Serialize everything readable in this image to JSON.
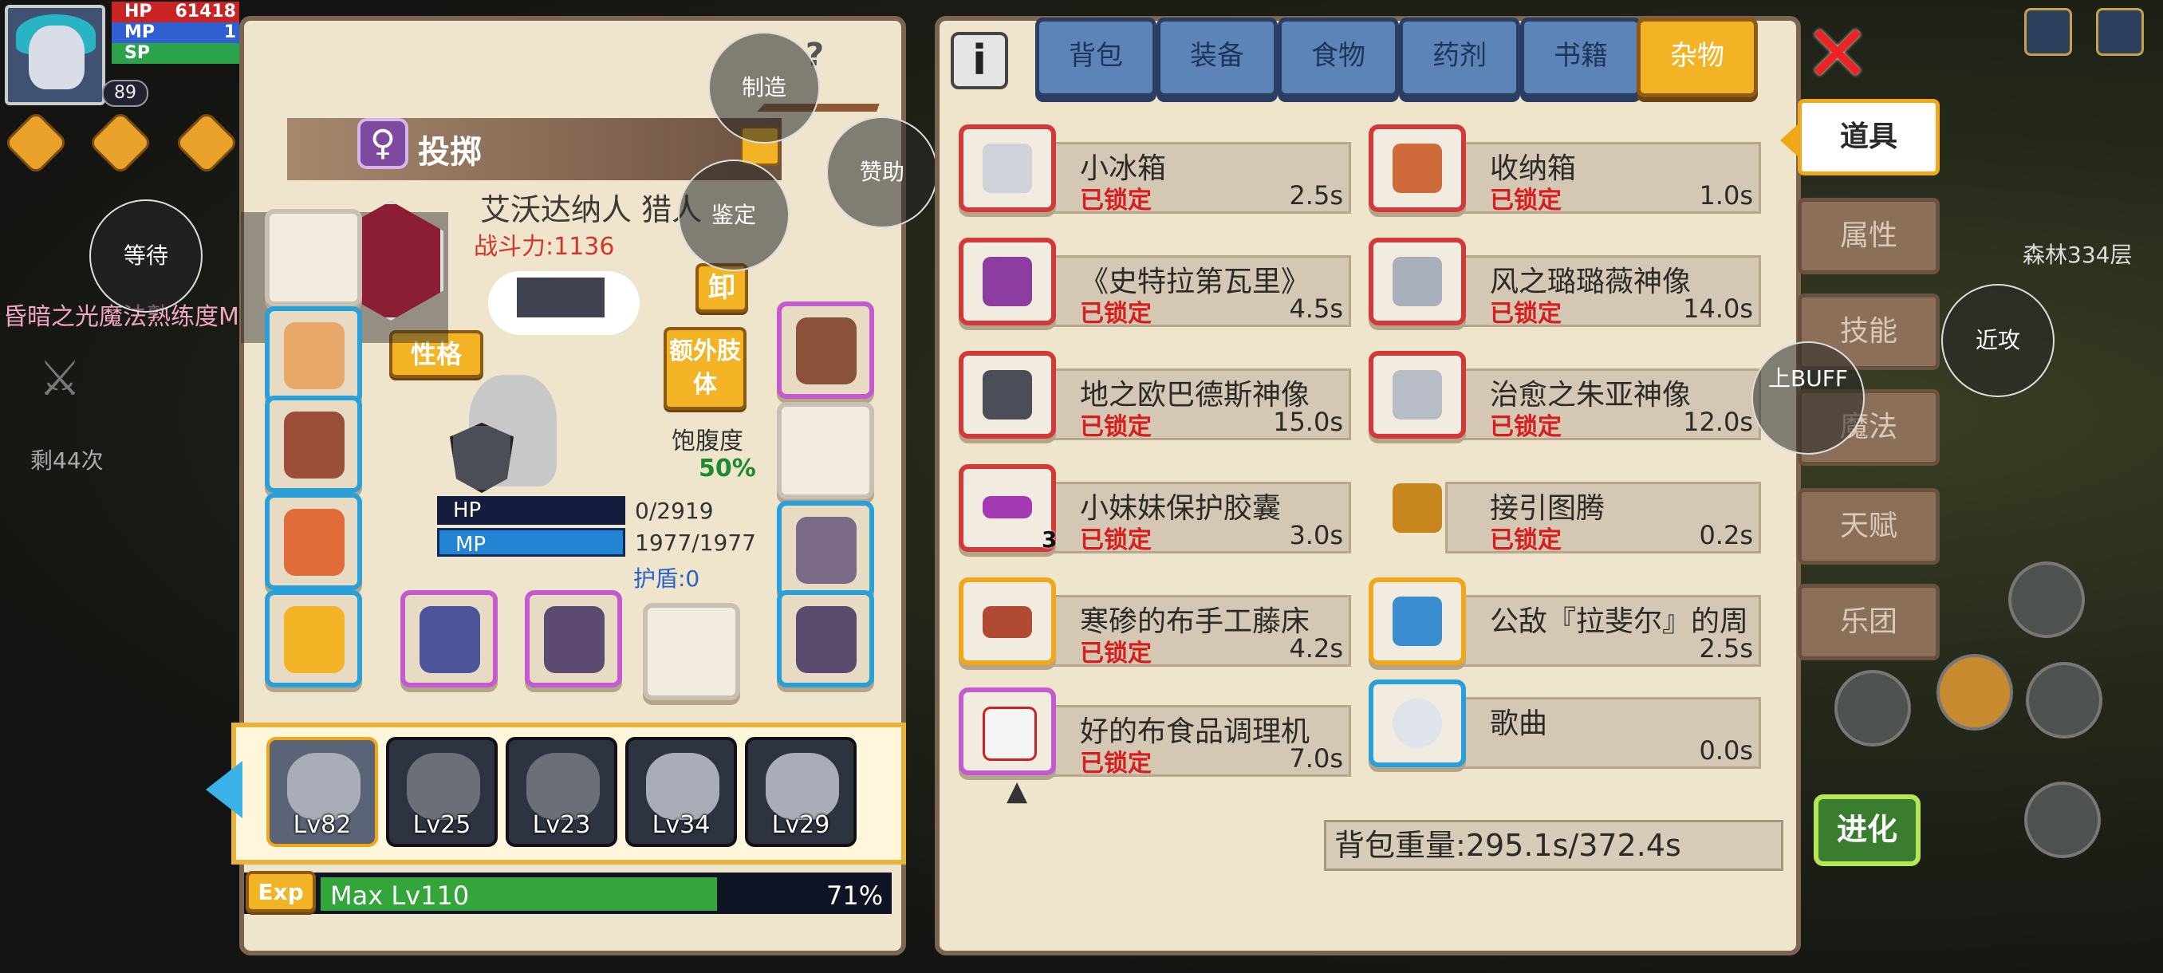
{
  "hud": {
    "level": "89",
    "hp_label": "HP",
    "hp_value": "61418",
    "mp_label": "MP",
    "mp_value": "1",
    "sp_label": "SP",
    "status_message": "昏暗之光魔法熟练度MAX。",
    "remaining": "剩44次"
  },
  "overlay_buttons": {
    "wait": "等待",
    "craft": "制造",
    "sponsor": "赞助",
    "appraise": "鉴定",
    "melee": "近攻",
    "buff": "上BUFF"
  },
  "character": {
    "skill_name": "投掷",
    "name": "艾沃达纳人 猎人",
    "power": "战斗力:1136",
    "unequip": "卸",
    "extra_limb": "额外肢体",
    "personality": "性格",
    "satiety_label": "饱腹度",
    "satiety_value": "50%",
    "hp_label": "HP",
    "hp_value": "0/2919",
    "mp_label": "MP",
    "mp_value": "1977/1977",
    "shield": "护盾:0"
  },
  "team": [
    {
      "level": "Lv82"
    },
    {
      "level": "Lv25"
    },
    {
      "level": "Lv23"
    },
    {
      "level": "Lv34"
    },
    {
      "level": "Lv29"
    }
  ],
  "exp": {
    "tag": "Exp",
    "text": "Max Lv110",
    "percent": "71%",
    "fill_fraction": 0.71
  },
  "inventory": {
    "tabs": [
      "背包",
      "装备",
      "食物",
      "药剂",
      "书籍",
      "杂物"
    ],
    "active_tab": "杂物",
    "items": [
      {
        "name": "小冰箱",
        "lock": "已锁定",
        "weight": "2.5s"
      },
      {
        "name": "收纳箱",
        "lock": "已锁定",
        "weight": "1.0s"
      },
      {
        "name": "《史特拉第瓦里》",
        "lock": "已锁定",
        "weight": "4.5s"
      },
      {
        "name": "风之璐璐薇神像",
        "lock": "已锁定",
        "weight": "14.0s"
      },
      {
        "name": "地之欧巴德斯神像",
        "lock": "已锁定",
        "weight": "15.0s"
      },
      {
        "name": "治愈之朱亚神像",
        "lock": "已锁定",
        "weight": "12.0s"
      },
      {
        "name": "小妹妹保护胶囊",
        "lock": "已锁定",
        "weight": "3.0s",
        "qty": "3"
      },
      {
        "name": "接引图腾",
        "lock": "已锁定",
        "weight": "0.2s"
      },
      {
        "name": "寒碜的布手工藤床",
        "lock": "已锁定",
        "weight": "4.2s"
      },
      {
        "name": "公敌『拉斐尔』的周",
        "lock": "",
        "weight": "2.5s"
      },
      {
        "name": "好的布食品调理机",
        "lock": "已锁定",
        "weight": "7.0s"
      },
      {
        "name": "歌曲",
        "lock": "",
        "weight": "0.0s"
      }
    ],
    "weight": "背包重量:295.1s/372.4s"
  },
  "side_tabs": [
    "道具",
    "属性",
    "技能",
    "魔法",
    "天赋",
    "乐团"
  ],
  "side_active": "道具",
  "evolve": "进化",
  "map_label": "森林334层",
  "colors": {
    "tab_blue": "#5d84b8",
    "tab_active": "#f2b425",
    "lock_red": "#d71e1e",
    "panel": "#efe4cc"
  }
}
